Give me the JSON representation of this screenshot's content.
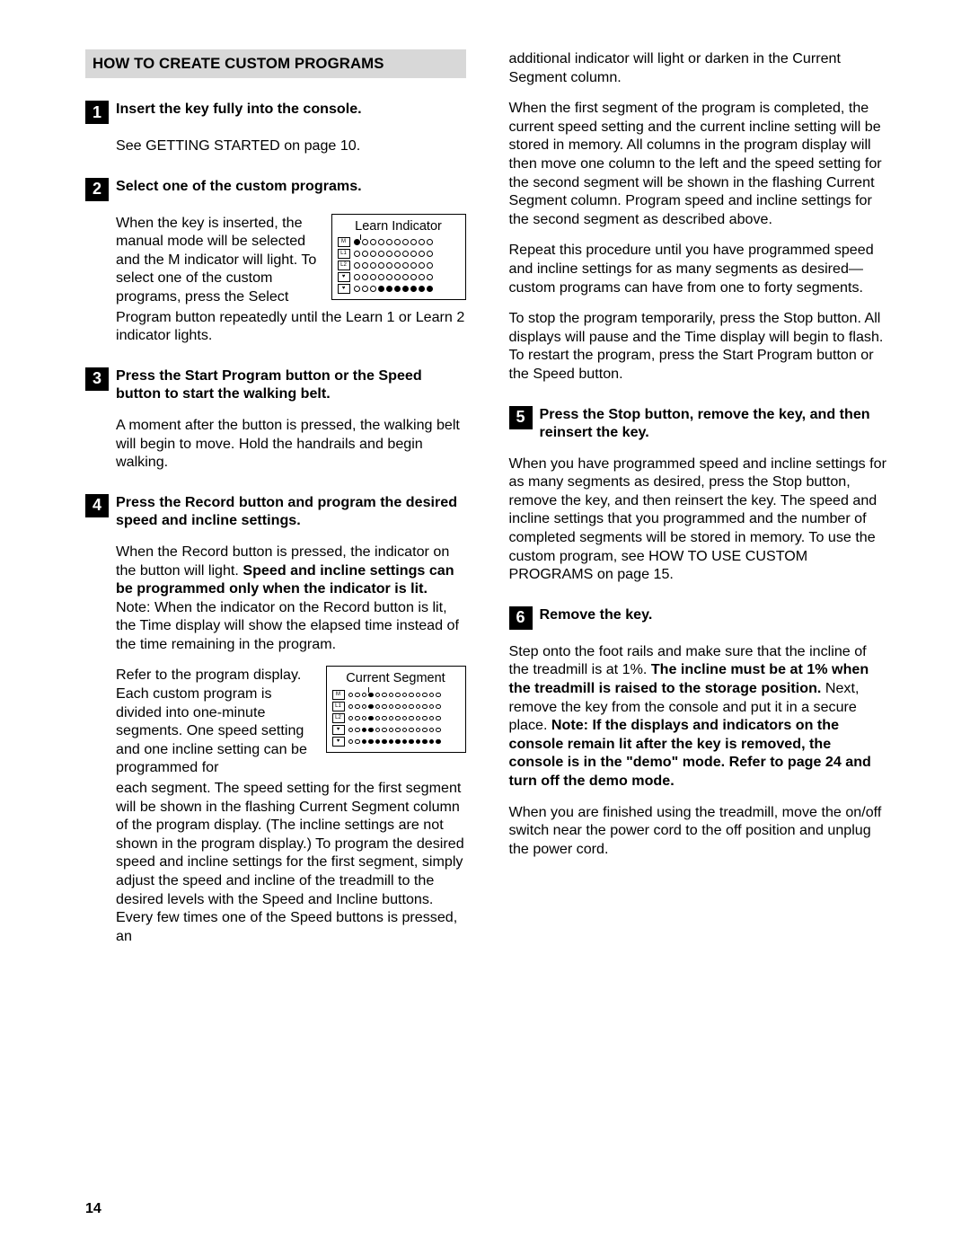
{
  "header": "HOW TO CREATE CUSTOM PROGRAMS",
  "pageNumber": "14",
  "step1": {
    "num": "1",
    "title": "Insert the key fully into the console.",
    "body1": "See GETTING STARTED on page 10."
  },
  "step2": {
    "num": "2",
    "title": "Select one of the custom programs.",
    "body1": "When the key is in­serted, the manual mode will be selected and the M indicator will light. To select one of the custom programs, press the Select",
    "body2": "Program button repeatedly until the Learn 1 or Learn 2 indicator lights.",
    "diagramTitle": "Learn Indicator",
    "rowLabels": [
      "M",
      "L1",
      "L2",
      "♥",
      "♥"
    ]
  },
  "step3": {
    "num": "3",
    "title": "Press the Start Program button or the Speed button to start the walking belt.",
    "body1": "A moment after the button is pressed, the walking belt will begin to move. Hold the handrails and begin walking."
  },
  "step4": {
    "num": "4",
    "title": "Press the Record button and program the desired speed and incline settings.",
    "body1a": "When the Record button is pressed, the indicator on the button will light. ",
    "body1b": "Speed and incline settings can be programmed only when the indicator is lit.",
    "body1c": " Note: When the indicator on the Record button is lit, the Time display will show the elapsed time instead of the time remaining in the program.",
    "body2a": "Refer to the program display. Each custom program is divided into one-minute segments. One speed setting and one incline setting can be programmed for",
    "body2b": "each segment. The speed setting for the first seg­ment will be shown in the flashing Current Segment column of the program display. (The in­cline settings are not shown in the program dis­play.) To program the desired speed and incline settings for the first segment, simply adjust the speed and incline of the treadmill to the desired levels with the Speed and Incline buttons. Every few times one of the Speed buttons is pressed, an",
    "diagramTitle": "Current Segment",
    "rowLabels": [
      "M",
      "L1",
      "L2",
      "♥",
      "♥"
    ]
  },
  "rightCol": {
    "cont1": "additional indicator will light or darken in the Current Segment column.",
    "cont2": "When the first segment of the program is com­pleted, the current speed setting and the current incline setting will be stored in memory. All columns in the program display will then move one column to the left and the speed setting for the second segment will be shown in the flashing Current Segment column. Program speed and incline settings for the second segment as de­scribed above.",
    "cont3": "Repeat this procedure until you have programmed speed and incline settings for as many segments as desired—custom programs can have from one to forty segments.",
    "cont4": "To stop the program temporarily, press the Stop button. All displays will pause and the Time dis­play will begin to flash. To restart the program, press the Start Program button or the Speed button."
  },
  "step5": {
    "num": "5",
    "title": "Press the Stop button, remove the key, and then reinsert the key.",
    "body1": "When you have programmed speed and incline settings for as many segments as desired, press the Stop button, remove the key, and then reinsert the key. The speed and incline settings that you programmed and the number of completed segments will be stored in memory. To use the custom program, see HOW TO USE CUSTOM PROGRAMS on page 15."
  },
  "step6": {
    "num": "6",
    "title": "Remove the key.",
    "body1a": "Step onto the foot rails and make sure that the in­cline of the treadmill is at 1%. ",
    "body1b": "The incline must be at 1% when the treadmill is raised to the storage position.",
    "body1c": " Next, remove the key from the console and put it in a secure place. ",
    "body1d": "Note: If the displays and indicators on the console remain lit after the key is removed, the console is in the \"demo\" mode. Refer to page 24 and turn off the demo mode.",
    "body2": "When you are finished using the treadmill, move the on/off switch near the power cord to the off position and unplug the power cord."
  }
}
